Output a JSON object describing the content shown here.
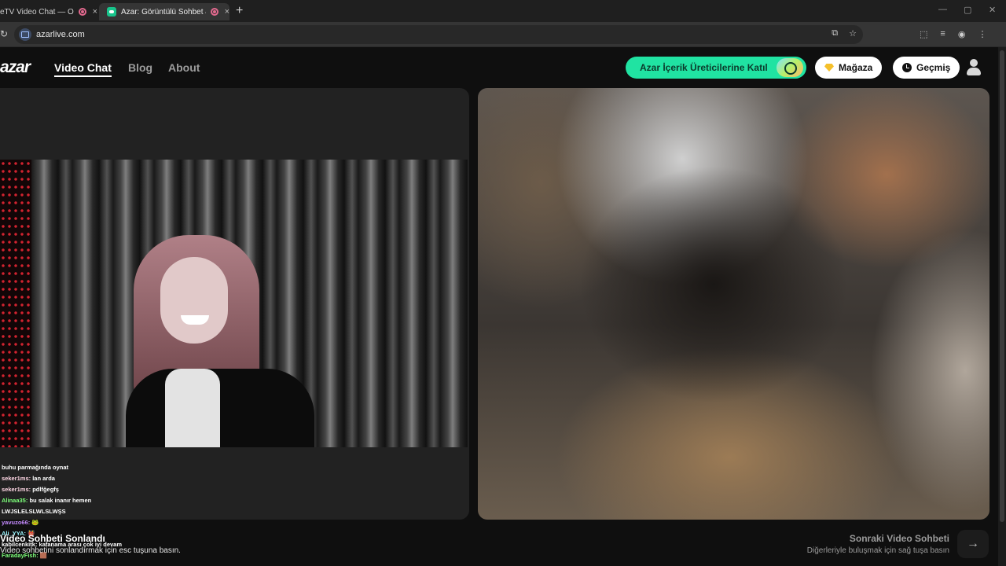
{
  "browser": {
    "tabs": [
      {
        "title": "eTV Video Chat — Ome",
        "close": "×"
      },
      {
        "title": "Azar: Görüntülü Sohbet & ",
        "close": "×"
      }
    ],
    "new_tab": "+",
    "url": "azarlive.com",
    "window_controls": [
      "—",
      "▢",
      "✕"
    ]
  },
  "site": {
    "logo": "azar",
    "nav": [
      {
        "label": "Video Chat",
        "active": true
      },
      {
        "label": "Blog",
        "active": false
      },
      {
        "label": "About",
        "active": false
      }
    ],
    "creator_button": "Azar İçerik Üreticilerine Katıl",
    "shop_button": "Mağaza",
    "history_button": "Geçmiş",
    "colors": {
      "accent": "#20e3a2",
      "background": "#0f0f0f",
      "panel": "#222222"
    }
  },
  "chat": [
    {
      "user": "",
      "text": "buhu parmağında oynat",
      "color": "#ffffff"
    },
    {
      "user": "seker1ms",
      "text": "lan arda",
      "color": "#ffd7e5"
    },
    {
      "user": "seker1ms",
      "text": "pdlfğegfş",
      "color": "#ffd7e5"
    },
    {
      "user": "Alinaa35",
      "text": "bu salak inanır hemen",
      "color": "#7dff7a"
    },
    {
      "user": "",
      "text": "LWJSLELSLWLSLWŞS",
      "color": "#ffffff"
    },
    {
      "user": "yavuzo66",
      "text": "🐸",
      "color": "#c58bff"
    },
    {
      "user": "Ali_YYA",
      "text": "👹",
      "color": "#9af7ff"
    },
    {
      "user": "",
      "text": "kabilcenkitk: kafanama arası çok iyi devam",
      "color": "#ffffff"
    },
    {
      "user": "FaradayFish",
      "text": "🟫",
      "color": "#7dff7a"
    }
  ],
  "ended": {
    "title": "Video Sohbeti Sonlandı",
    "subtitle": "Video sohbetini sonlandırmak için esc tuşuna basın."
  },
  "next": {
    "title": "Sonraki Video Sohbeti",
    "subtitle": "Diğerleriyle buluşmak için sağ tuşa basın",
    "arrow": "→"
  }
}
